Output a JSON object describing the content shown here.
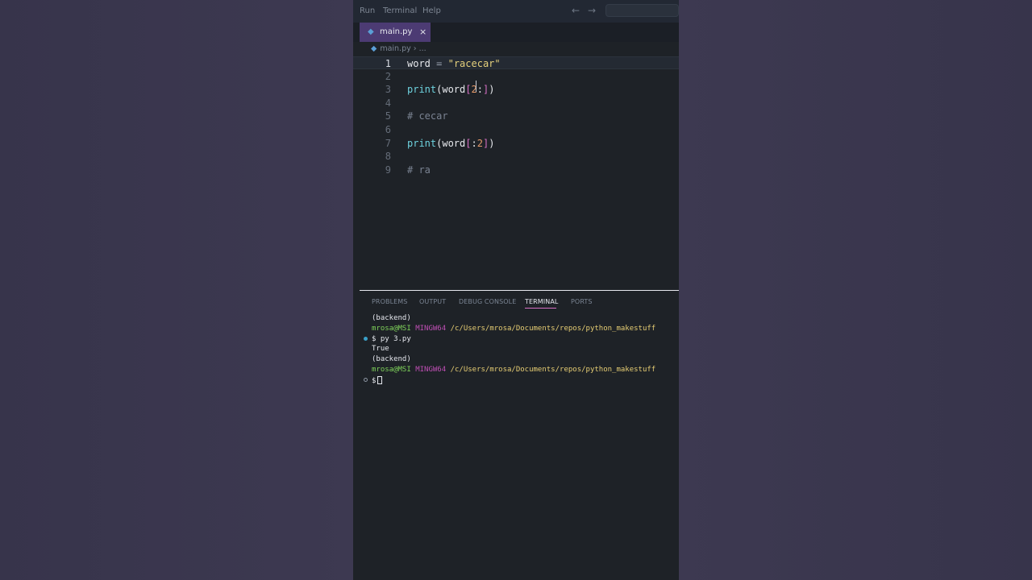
{
  "menubar": {
    "items": [
      "Run",
      "Terminal",
      "Help"
    ],
    "back_icon": "arrow-left-icon",
    "forward_icon": "arrow-right-icon"
  },
  "tabs": [
    {
      "label": "main.py",
      "icon": "python-file-icon",
      "close": "×",
      "active": true
    }
  ],
  "breadcrumb": {
    "file": "main.py",
    "sep": "›",
    "rest": "..."
  },
  "editor": {
    "lines": [
      {
        "n": "1",
        "text": "word = \"racecar\""
      },
      {
        "n": "2",
        "text": ""
      },
      {
        "n": "3",
        "text": "print(word[2:])"
      },
      {
        "n": "4",
        "text": ""
      },
      {
        "n": "5",
        "text": "# cecar"
      },
      {
        "n": "6",
        "text": ""
      },
      {
        "n": "7",
        "text": "print(word[:2])"
      },
      {
        "n": "8",
        "text": ""
      },
      {
        "n": "9",
        "text": "# ra"
      }
    ],
    "current_line": "1"
  },
  "panel": {
    "tabs": [
      "PROBLEMS",
      "OUTPUT",
      "DEBUG CONSOLE",
      "TERMINAL",
      "PORTS"
    ],
    "active_tab": "TERMINAL"
  },
  "terminal": {
    "lines": [
      {
        "env": "(backend)"
      },
      {
        "user": "mrosa@MSI",
        "shell": "MINGW64",
        "path": "/c/Users/mrosa/Documents/repos/python_makestuff"
      },
      {
        "cmd": "$ py 3.py"
      },
      {
        "out": "True"
      },
      {
        "env": "(backend)"
      },
      {
        "user": "mrosa@MSI",
        "shell": "MINGW64",
        "path": "/c/Users/mrosa/Documents/repos/python_makestuff"
      },
      {
        "prompt": "$"
      }
    ]
  },
  "colors": {
    "accent_tab": "#4c3b73",
    "terminal_underline": "#d66fc4",
    "user_green": "#7fd35a",
    "path_yellow": "#e6cd73",
    "mingw_magenta": "#c04fb5"
  }
}
